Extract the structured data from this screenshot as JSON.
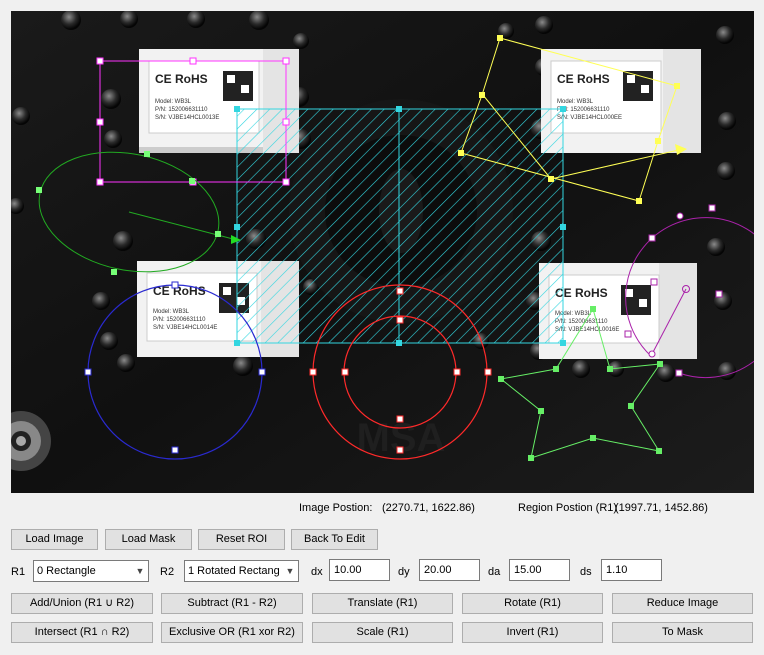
{
  "status": {
    "image_position_label": "Image Postion:",
    "image_position_value": "(2270.71, 1622.86)",
    "region_position_label": "Region Postion (R1)",
    "region_position_value": "(1997.71, 1452.86)"
  },
  "toolbar": {
    "load_image": "Load Image",
    "load_mask": "Load Mask",
    "reset_roi": "Reset ROI",
    "back_to_edit": "Back To Edit"
  },
  "params": {
    "r1_label": "R1",
    "r1_value": "0 Rectangle",
    "r2_label": "R2",
    "r2_value": "1 Rotated Rectang",
    "dx_label": "dx",
    "dx_value": "10.00",
    "dy_label": "dy",
    "dy_value": "20.00",
    "da_label": "da",
    "da_value": "15.00",
    "ds_label": "ds",
    "ds_value": "1.10"
  },
  "ops": {
    "add_union": "Add/Union (R1 ∪ R2)",
    "subtract": "Subtract (R1 - R2)",
    "translate": "Translate (R1)",
    "rotate": "Rotate (R1)",
    "reduce_image": "Reduce Image",
    "intersect": "Intersect (R1 ∩ R2)",
    "xor": "Exclusive OR (R1 xor R2)",
    "scale": "Scale (R1)",
    "invert": "Invert (R1)",
    "to_mask": "To Mask"
  },
  "image": {
    "module_text": {
      "brand": "CE RoHS",
      "model": "Model: WB3L",
      "pn_top_left": "P/N: 152006631110",
      "sn_top_left": "S/N: VJBE14HCL0013E",
      "pn_top_right": "P/N: 152006631110",
      "sn_top_right": "S/N: VJBE14HCL000EE",
      "pn_bottom_left": "P/N: 152006631110",
      "sn_bottom_left": "S/N: VJBE14HCL0014E",
      "pn_bottom_right": "P/N: 152006631110",
      "sn_bottom_right": "S/N: VJBE14HCL0016E"
    },
    "colors": {
      "rect_roi": "#ff33ff",
      "hatched_roi": "#33d6e0",
      "ellipse_roi": "#22aa22",
      "circle_roi": "#2a2ad0",
      "ring_roi": "#ff2a2a",
      "polygon_roi": "#ffff55",
      "star_roi": "#66ee66",
      "arc_roi": "#aa22aa"
    }
  }
}
